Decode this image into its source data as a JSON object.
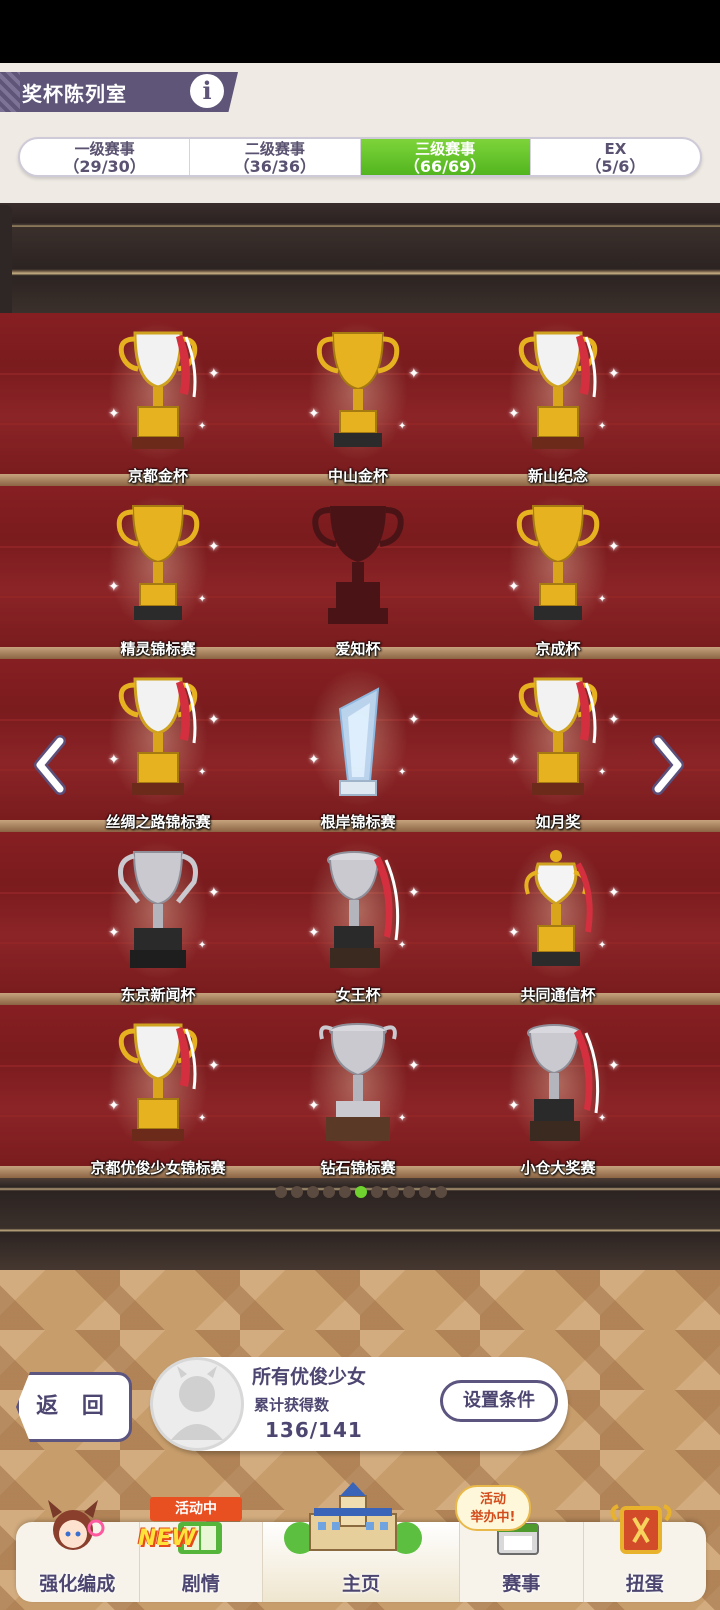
{
  "header": {
    "title": "奖杯陈列室",
    "info_glyph": "i"
  },
  "tabs": [
    {
      "label": "一级赛事",
      "count": "（29/30）",
      "active": false
    },
    {
      "label": "二级赛事",
      "count": "（36/36）",
      "active": false
    },
    {
      "label": "三级赛事",
      "count": "（66/69）",
      "active": true
    },
    {
      "label": "EX",
      "count": "（5/6）",
      "active": false
    }
  ],
  "trophies": [
    {
      "name": "京都金杯",
      "kind": "gold-ribbon",
      "locked": false
    },
    {
      "name": "中山金杯",
      "kind": "gold",
      "locked": false
    },
    {
      "name": "新山纪念",
      "kind": "gold-ribbon",
      "locked": false
    },
    {
      "name": "精灵锦标赛",
      "kind": "gold",
      "locked": false
    },
    {
      "name": "爱知杯",
      "kind": "silhouette",
      "locked": true
    },
    {
      "name": "京成杯",
      "kind": "gold",
      "locked": false
    },
    {
      "name": "丝绸之路锦标赛",
      "kind": "gold-ribbon",
      "locked": false
    },
    {
      "name": "根岸锦标赛",
      "kind": "crystal",
      "locked": false
    },
    {
      "name": "如月奖",
      "kind": "gold-ribbon",
      "locked": false
    },
    {
      "name": "东京新闻杯",
      "kind": "silver",
      "locked": false
    },
    {
      "name": "女王杯",
      "kind": "silver-ribbon",
      "locked": false
    },
    {
      "name": "共同通信杯",
      "kind": "gold-urn",
      "locked": false
    },
    {
      "name": "京都优俊少女锦标赛",
      "kind": "gold-ribbon",
      "locked": false
    },
    {
      "name": "钻石锦标赛",
      "kind": "silver-urn",
      "locked": false
    },
    {
      "name": "小仓大奖赛",
      "kind": "silver-ribbon",
      "locked": false
    }
  ],
  "pagination": {
    "total": 11,
    "current": 6
  },
  "back_button": "返 回",
  "info_panel": {
    "title": "所有优俊少女",
    "subtitle": "累计获得数",
    "count": "136/141",
    "filter_button": "设置条件"
  },
  "nav": [
    {
      "label": "强化编成",
      "icon": "character-icon"
    },
    {
      "label": "剧情",
      "icon": "story-book-icon"
    },
    {
      "label": "主页",
      "icon": "school-building-icon"
    },
    {
      "label": "赛事",
      "icon": "race-icon"
    },
    {
      "label": "扭蛋",
      "icon": "gacha-icon"
    }
  ],
  "badges": {
    "new": "NEW",
    "story_ribbon": "活动中",
    "race_bubble_line1": "活动",
    "race_bubble_line2": "举办中!"
  },
  "colors": {
    "accent_green": "#6fd22e",
    "tab_active": "#52b51f",
    "panel_text": "#4d4670",
    "shelf_red": "#7a1d1f",
    "gold": "#e6b21f",
    "silver": "#c9c9cf"
  }
}
